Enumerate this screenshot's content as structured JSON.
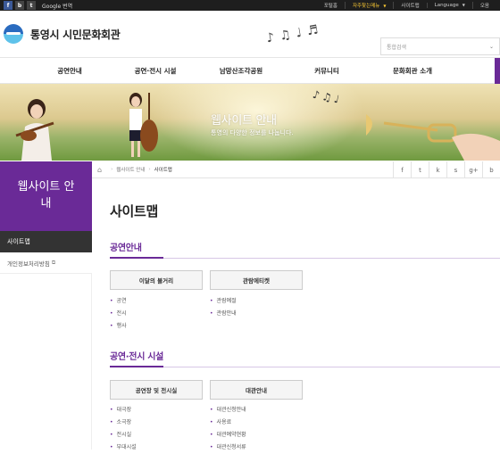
{
  "topbar": {
    "social": [
      "f",
      "b",
      "t"
    ],
    "translate": "Google 번역",
    "links": [
      "포털홈",
      "자주찾는메뉴",
      "사이트맵",
      "Language",
      "오음"
    ]
  },
  "header": {
    "logo_text": "통영시 시민문화회관",
    "search_label": "통합검색"
  },
  "nav": {
    "items": [
      "공연안내",
      "공연·전시 시설",
      "남망산조각공원",
      "커뮤니티",
      "문화회관 소개"
    ]
  },
  "banner": {
    "title": "웹사이트 안내",
    "subtitle": "통영의 다양한 정보를 나눕니다."
  },
  "sidebar": {
    "heading": "웹사이트 안내",
    "items": [
      "사이트맵",
      "개인정보처리방침"
    ]
  },
  "breadcrumb": {
    "items": [
      "웹사이트 안내",
      "사이트맵"
    ]
  },
  "share_icons": [
    "f",
    "t",
    "k",
    "s",
    "g+",
    "b"
  ],
  "main": {
    "title": "사이트맵",
    "sections": [
      {
        "title": "공연안내",
        "groups": [
          {
            "label": "이달의 볼거리",
            "items": [
              "공연",
              "전시",
              "행사"
            ]
          },
          {
            "label": "관람에티켓",
            "items": [
              "관람예절",
              "관람안내"
            ]
          }
        ]
      },
      {
        "title": "공연·전시 시설",
        "groups": [
          {
            "label": "공연장 및 전시실",
            "items": [
              "대극장",
              "소극장",
              "전시실",
              "부대시설"
            ]
          },
          {
            "label": "대관안내",
            "items": [
              "대관신청안내",
              "사용료",
              "대관예약현황",
              "대관신청서류"
            ]
          }
        ]
      }
    ]
  },
  "colors": {
    "accent": "#6a2a97",
    "topbar": "#1e1e1e"
  }
}
